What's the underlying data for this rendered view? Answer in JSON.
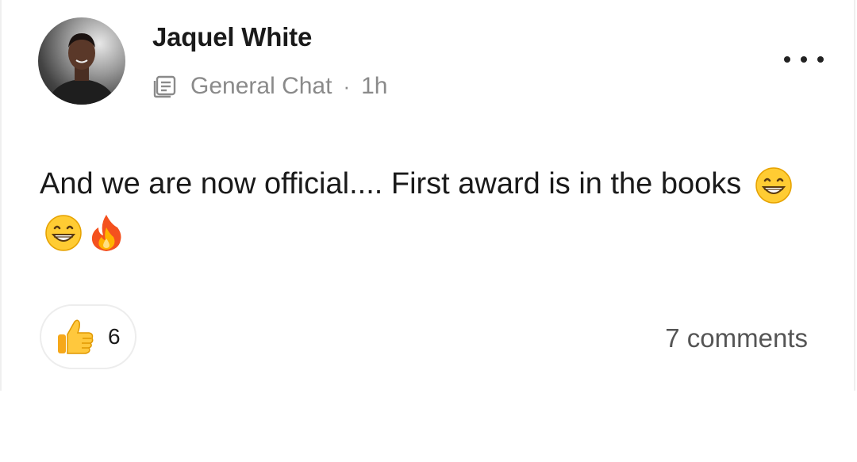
{
  "post": {
    "author": "Jaquel White",
    "channel_icon": "document-icon",
    "channel": "General Chat",
    "separator": "·",
    "time": "1h",
    "more_icon": "more-horizontal-icon",
    "text": "And we are now official.... First award is in the books",
    "emojis": [
      "grinning-face-emoji",
      "grinning-face-emoji",
      "fire-emoji"
    ]
  },
  "reactions": {
    "icon": "thumbs-up-icon",
    "count": "6"
  },
  "comments": {
    "label": "7 comments"
  },
  "colors": {
    "text_primary": "#1a1a1a",
    "text_secondary": "#8a8a8a",
    "border": "#ededed"
  }
}
